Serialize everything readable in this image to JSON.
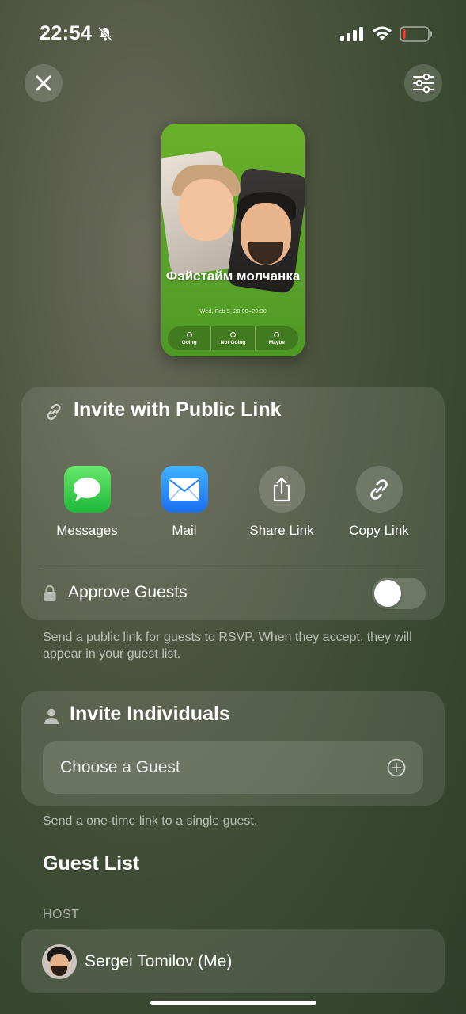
{
  "status_bar": {
    "time": "22:54",
    "icons": [
      "bell-slash-icon",
      "cellular-signal-icon",
      "wifi-icon",
      "battery-low-icon"
    ]
  },
  "top_bar": {
    "close_icon": "close-icon",
    "settings_icon": "sliders-icon"
  },
  "poster": {
    "title": "Фэйстайм молчанка",
    "date": "Wed, Feb 5, 20:00–20:30",
    "rsvp_options": [
      "Going",
      "Not Going",
      "Maybe"
    ]
  },
  "invite_public": {
    "title": "Invite with Public Link",
    "icon": "link-icon",
    "share_options": [
      {
        "label": "Messages",
        "icon": "messages-icon"
      },
      {
        "label": "Mail",
        "icon": "mail-icon"
      },
      {
        "label": "Share Link",
        "icon": "share-icon"
      },
      {
        "label": "Copy Link",
        "icon": "link-icon"
      }
    ],
    "approve_guests_label": "Approve Guests",
    "approve_guests_enabled": false,
    "note": "Send a public link for guests to RSVP. When they accept, they will appear in your guest list."
  },
  "invite_individuals": {
    "title": "Invite Individuals",
    "icon": "person-icon",
    "choose_guest_label": "Choose a Guest",
    "note": "Send a one-time link to a single guest."
  },
  "guest_list": {
    "title": "Guest List",
    "host_label": "HOST",
    "host_name": "Sergei Tomilov (Me)"
  },
  "colors": {
    "messages_green": "#28c840",
    "mail_blue": "#1a8cff",
    "poster_green": "#5aa326"
  }
}
